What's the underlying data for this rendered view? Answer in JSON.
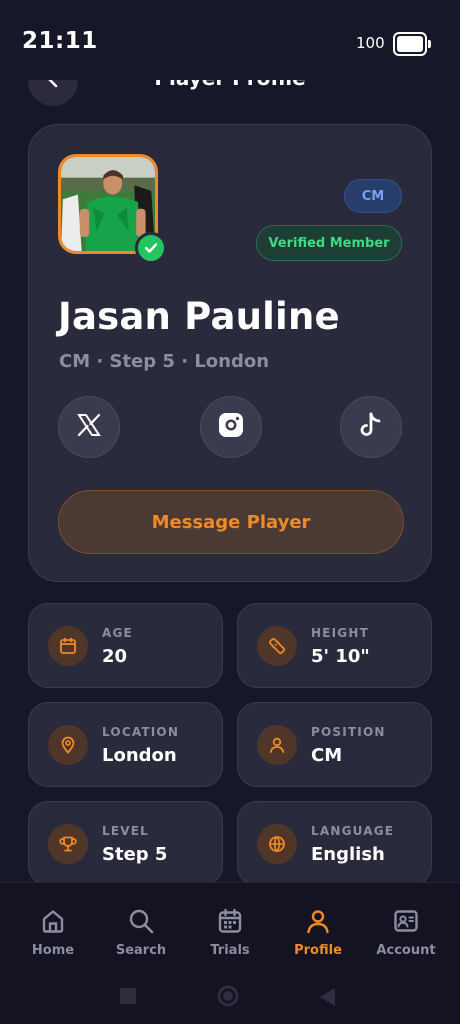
{
  "status_bar": {
    "time": "21:11",
    "battery_level": "100"
  },
  "header": {
    "title": "Player Profile",
    "back_icon": "chevron-left-icon"
  },
  "profile": {
    "name": "Jasan Pauline",
    "meta": "CM · Step 5 · London",
    "position_badge": "CM",
    "verified_label": "Verified Member",
    "message_button": "Message Player",
    "socials": [
      {
        "name": "x-icon"
      },
      {
        "name": "instagram-icon"
      },
      {
        "name": "tiktok-icon"
      }
    ]
  },
  "stats": [
    {
      "label": "AGE",
      "value": "20",
      "icon": "calendar-icon"
    },
    {
      "label": "HEIGHT",
      "value": "5' 10\"",
      "icon": "ruler-icon"
    },
    {
      "label": "LOCATION",
      "value": "London",
      "icon": "map-pin-icon"
    },
    {
      "label": "POSITION",
      "value": "CM",
      "icon": "user-icon"
    },
    {
      "label": "LEVEL",
      "value": "Step 5",
      "icon": "trophy-icon"
    },
    {
      "label": "LANGUAGE",
      "value": "English",
      "icon": "globe-icon"
    }
  ],
  "nav": {
    "items": [
      {
        "label": "Home",
        "icon": "home-icon"
      },
      {
        "label": "Search",
        "icon": "search-icon"
      },
      {
        "label": "Trials",
        "icon": "calendar-grid-icon"
      },
      {
        "label": "Profile",
        "icon": "profile-icon",
        "active": true
      },
      {
        "label": "Account",
        "icon": "id-card-icon"
      }
    ]
  },
  "colors": {
    "background": "#17172a",
    "card": "#2a2a3d",
    "accent": "#f08a24",
    "verified": "#22c55e",
    "badge_blue": "#74a3f3"
  }
}
